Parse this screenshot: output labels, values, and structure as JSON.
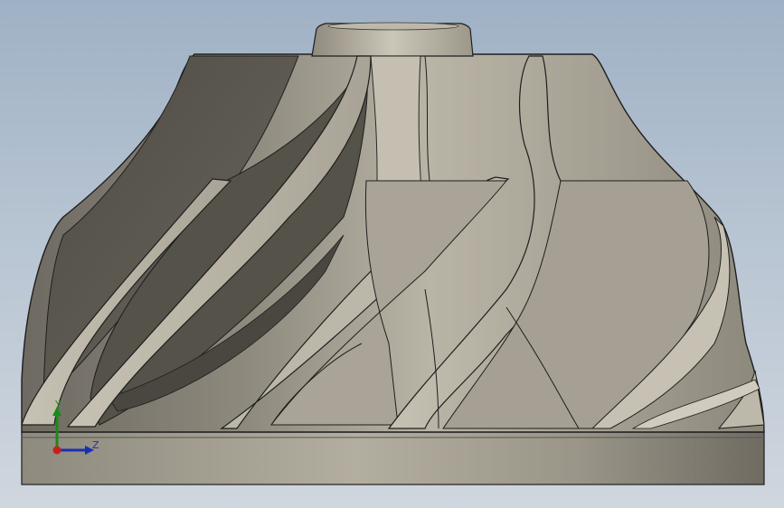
{
  "viewport": {
    "background_top": "#9fb1c5",
    "background_bottom": "#cfd6de"
  },
  "triad": {
    "y_label": "Y",
    "z_label": "Z",
    "y_color": "#1a8a1a",
    "z_color": "#1a2fb0",
    "x_color": "#c81e1e"
  },
  "model": {
    "part": "impeller",
    "surface_color": "#b5b0a2",
    "edge_color": "#1e1e1e"
  }
}
